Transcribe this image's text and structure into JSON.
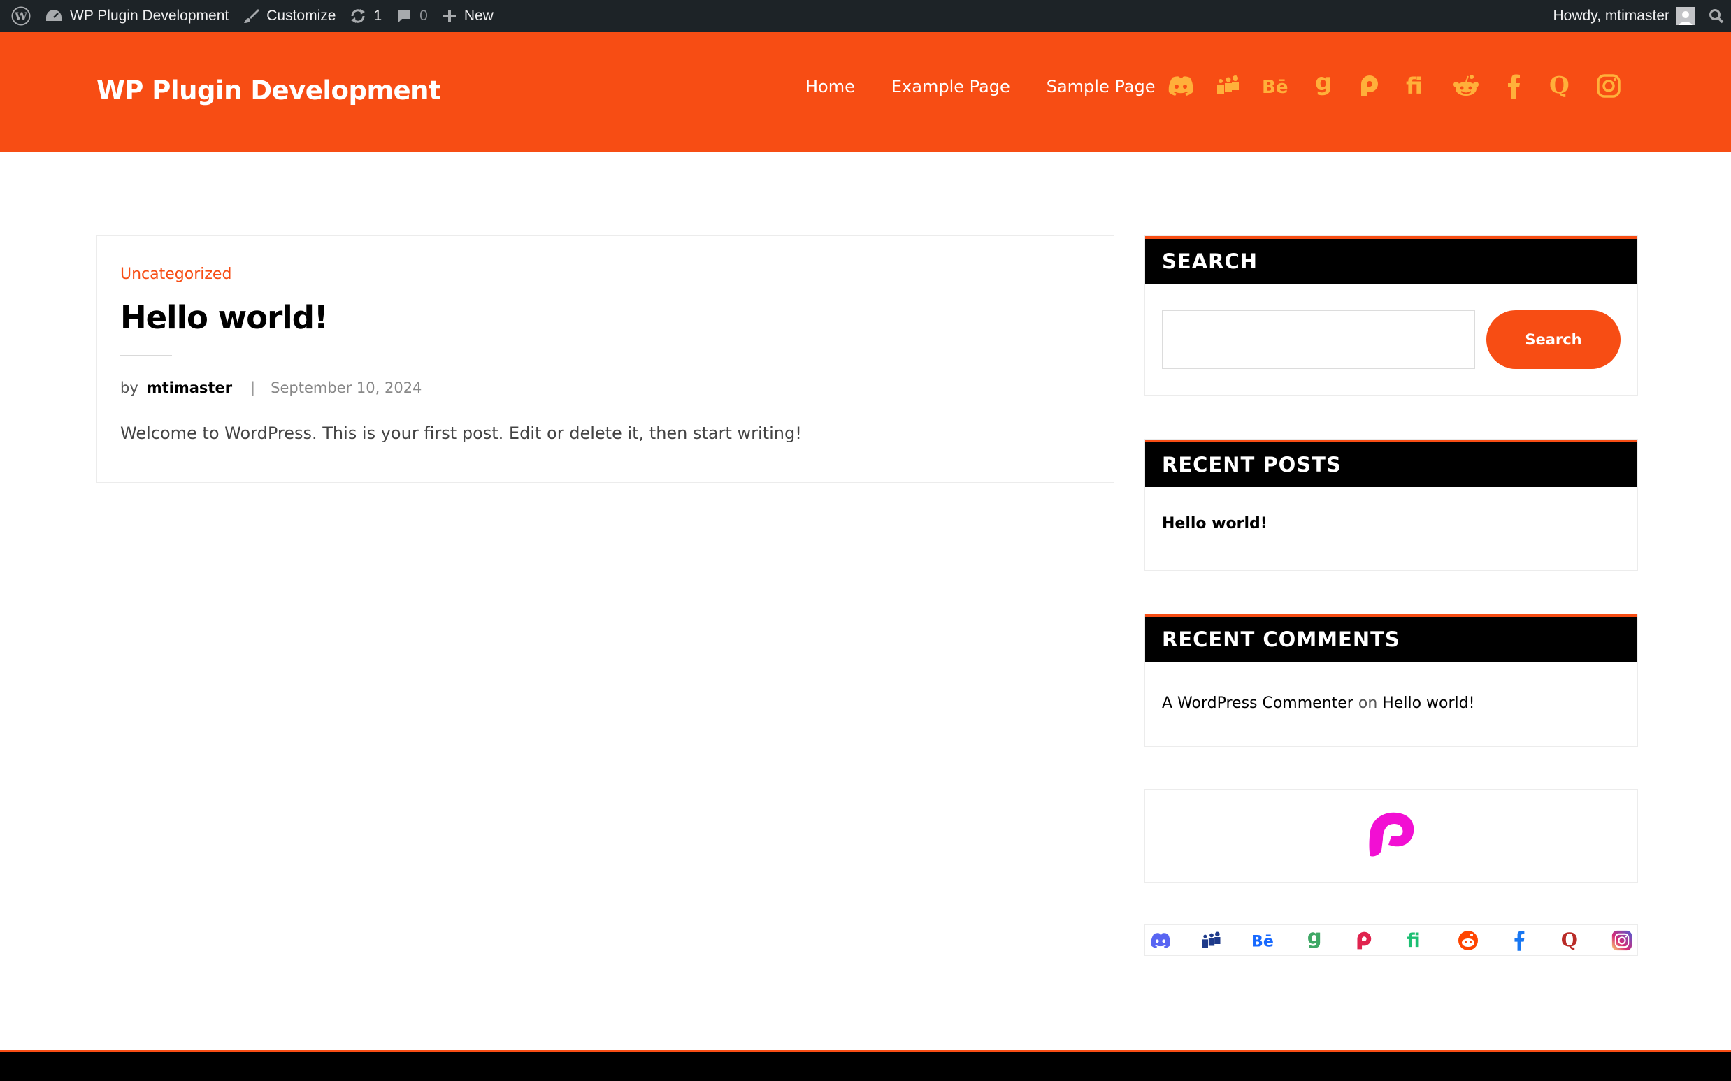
{
  "adminbar": {
    "site_name": "WP Plugin Development",
    "customize": "Customize",
    "updates_count": "1",
    "comments_count": "0",
    "new_label": "New",
    "howdy": "Howdy, mtimaster"
  },
  "header": {
    "site_title": "WP Plugin Development",
    "nav": [
      "Home",
      "Example Page",
      "Sample Page"
    ],
    "social_icons": [
      "discord-icon",
      "myspace-icon",
      "behance-icon",
      "goodreads-icon",
      "patreon-icon",
      "fiverr-icon",
      "reddit-icon",
      "facebook-icon",
      "quora-icon",
      "instagram-icon"
    ],
    "icon_color": "#ffb03a",
    "brand_color": "#f74d14"
  },
  "post": {
    "category": "Uncategorized",
    "title": "Hello world!",
    "by": "by",
    "author": "mtimaster",
    "separator": "|",
    "date": "September 10, 2024",
    "excerpt": "Welcome to WordPress. This is your first post. Edit or delete it, then start writing!"
  },
  "sidebar": {
    "search": {
      "title": "SEARCH",
      "input_value": "",
      "button_label": "Search"
    },
    "recent_posts": {
      "title": "RECENT POSTS",
      "items": [
        "Hello world!"
      ]
    },
    "recent_comments": {
      "title": "RECENT COMMENTS",
      "author": "A WordPress Commenter",
      "on": "on",
      "post": "Hello world!"
    },
    "logo_widget": {
      "icon": "patreon-logo-icon",
      "color": "#f20fd3"
    },
    "colored_icons": [
      "discord-icon",
      "myspace-icon",
      "behance-icon",
      "goodreads-icon",
      "patreon-icon",
      "fiverr-icon",
      "reddit-icon",
      "facebook-icon",
      "quora-icon",
      "instagram-icon"
    ]
  }
}
